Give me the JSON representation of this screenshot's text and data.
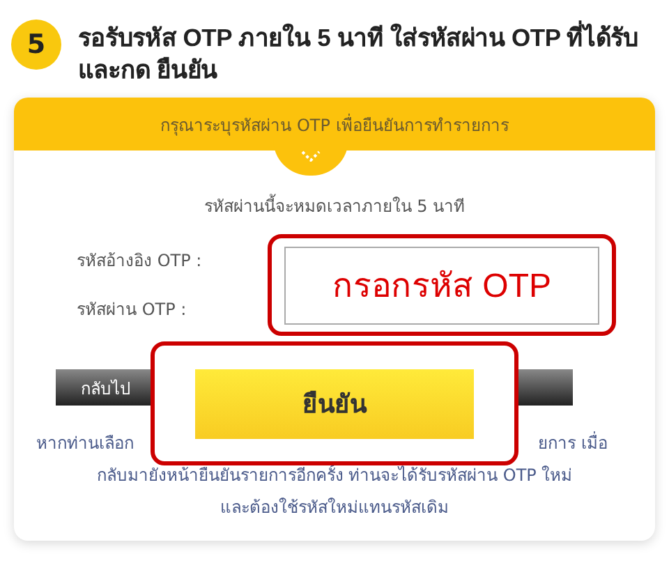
{
  "step": {
    "number": "5",
    "title": "รอรับรหัส OTP ภายใน 5 นาที ใส่รหัสผ่าน OTP ที่ได้รับและกด ยืนยัน"
  },
  "card": {
    "header": "กรุณาระบุรหัสผ่าน OTP เพื่อยืนยันการทำรายการ",
    "expiry_note": "รหัสผ่านนี้จะหมดเวลาภายใน 5 นาที",
    "fields": [
      {
        "label": "รหัสอ้างอิง OTP :"
      },
      {
        "label": "รหัสผ่าน OTP :"
      }
    ],
    "back_button": "กลับไป",
    "note_lines": [
      {
        "parts": [
          "หากท่านเลือก",
          "ยการ เมื่อ"
        ]
      },
      {
        "parts": [
          "กลับมายังหน้ายืนยันรายการอีกครั้ง ท่านจะได้รับรหัสผ่าน OTP ใหม่"
        ]
      },
      {
        "parts": [
          "และต้องใช้รหัสใหม่แทนรหัสเดิม"
        ]
      }
    ]
  },
  "callouts": {
    "otp_field": {
      "text": "กรอกรหัส OTP"
    },
    "confirm_button": "ยืนยัน"
  }
}
